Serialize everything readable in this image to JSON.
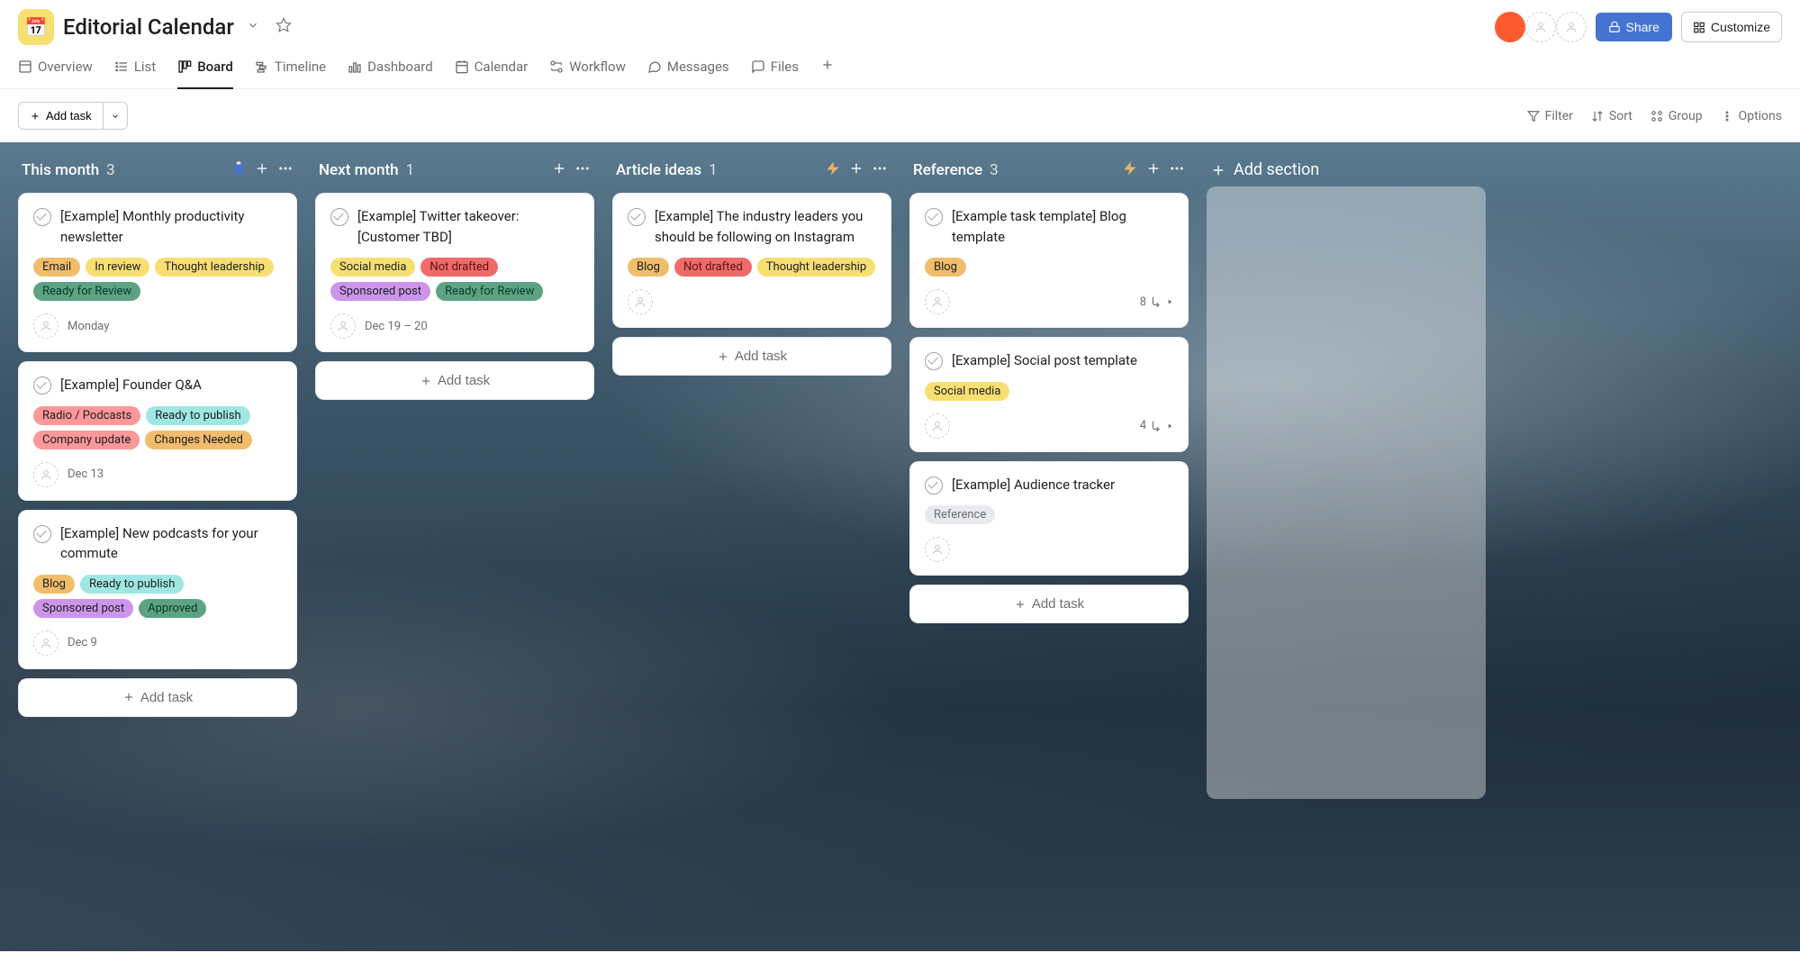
{
  "project": {
    "icon": "📅",
    "title": "Editorial Calendar"
  },
  "header": {
    "share": "Share",
    "customize": "Customize"
  },
  "tabs": [
    {
      "id": "overview",
      "label": "Overview"
    },
    {
      "id": "list",
      "label": "List"
    },
    {
      "id": "board",
      "label": "Board"
    },
    {
      "id": "timeline",
      "label": "Timeline"
    },
    {
      "id": "dashboard",
      "label": "Dashboard"
    },
    {
      "id": "calendar",
      "label": "Calendar"
    },
    {
      "id": "workflow",
      "label": "Workflow"
    },
    {
      "id": "messages",
      "label": "Messages"
    },
    {
      "id": "files",
      "label": "Files"
    }
  ],
  "active_tab": "board",
  "toolbar": {
    "add_task": "Add task",
    "filter": "Filter",
    "sort": "Sort",
    "group": "Group",
    "options": "Options"
  },
  "add_section_label": "Add section",
  "add_task_label": "Add task",
  "columns": [
    {
      "title": "This month",
      "count": "3",
      "rule_icon": "clipboard",
      "rule_color": "#4573d2",
      "cards": [
        {
          "title": "[Example] Monthly productivity newsletter",
          "tags": [
            {
              "label": "Email",
              "cls": "tag-email"
            },
            {
              "label": "In review",
              "cls": "tag-inreview"
            },
            {
              "label": "Thought leadership",
              "cls": "tag-thought"
            },
            {
              "label": "Ready for Review",
              "cls": "tag-readyreview"
            }
          ],
          "due": "Monday"
        },
        {
          "title": "[Example] Founder Q&A",
          "tags": [
            {
              "label": "Radio / Podcasts",
              "cls": "tag-radio"
            },
            {
              "label": "Ready to publish",
              "cls": "tag-readypublish"
            },
            {
              "label": "Company update",
              "cls": "tag-company"
            },
            {
              "label": "Changes Needed",
              "cls": "tag-changes"
            }
          ],
          "due": "Dec 13"
        },
        {
          "title": "[Example] New podcasts for your commute",
          "tags": [
            {
              "label": "Blog",
              "cls": "tag-blog"
            },
            {
              "label": "Ready to publish",
              "cls": "tag-readypublish"
            },
            {
              "label": "Sponsored post",
              "cls": "tag-sponsored"
            },
            {
              "label": "Approved",
              "cls": "tag-approved"
            }
          ],
          "due": "Dec 9"
        }
      ]
    },
    {
      "title": "Next month",
      "count": "1",
      "cards": [
        {
          "title": "[Example] Twitter takeover: [Customer TBD]",
          "tags": [
            {
              "label": "Social media",
              "cls": "tag-socialmedia"
            },
            {
              "label": "Not drafted",
              "cls": "tag-notdrafted"
            },
            {
              "label": "Sponsored post",
              "cls": "tag-sponsored"
            },
            {
              "label": "Ready for Review",
              "cls": "tag-readyreview"
            }
          ],
          "due": "Dec 19 – 20"
        }
      ]
    },
    {
      "title": "Article ideas",
      "count": "1",
      "rule_icon": "bolt",
      "rule_color": "#f1bd6c",
      "cards": [
        {
          "title": "[Example] The industry leaders you should be following on Instagram",
          "tags": [
            {
              "label": "Blog",
              "cls": "tag-blog"
            },
            {
              "label": "Not drafted",
              "cls": "tag-notdrafted"
            },
            {
              "label": "Thought leadership",
              "cls": "tag-thought"
            }
          ],
          "due": ""
        }
      ]
    },
    {
      "title": "Reference",
      "count": "3",
      "rule_icon": "bolt",
      "rule_color": "#f1bd6c",
      "cards": [
        {
          "title": "[Example task template] Blog template",
          "tags": [
            {
              "label": "Blog",
              "cls": "tag-blog"
            }
          ],
          "due": "",
          "subtasks": "8"
        },
        {
          "title": "[Example] Social post template",
          "tags": [
            {
              "label": "Social media",
              "cls": "tag-socialmedia"
            }
          ],
          "due": "",
          "subtasks": "4"
        },
        {
          "title": "[Example] Audience tracker",
          "tags": [
            {
              "label": "Reference",
              "cls": "tag-reference"
            }
          ],
          "due": ""
        }
      ]
    }
  ]
}
